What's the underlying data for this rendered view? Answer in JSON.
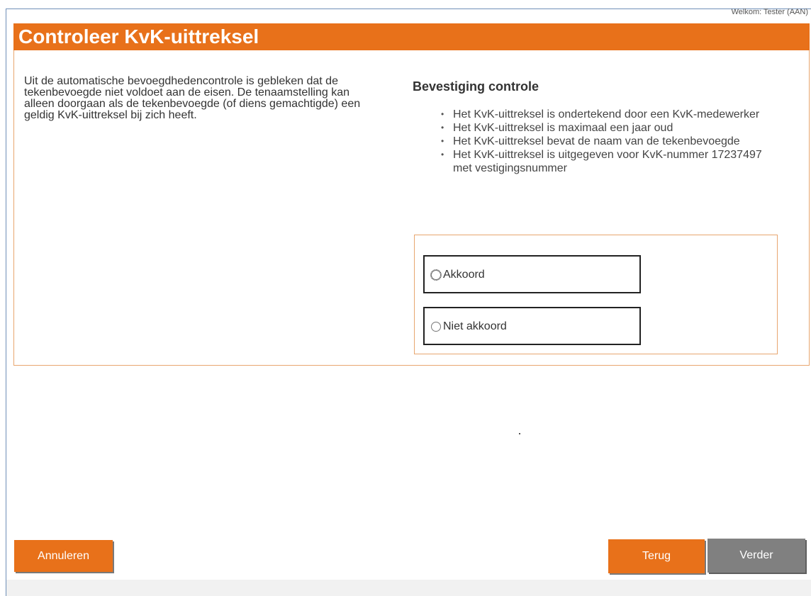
{
  "header": {
    "welcome": "Welkom: Tester (AAN)",
    "title": "Controleer KvK-uittreksel"
  },
  "intro": {
    "text": "Uit de automatische bevoegdhedencontrole is gebleken dat de tekenbevoegde niet voldoet aan de eisen. De tenaamstelling kan alleen doorgaan als de tekenbevoegde (of diens gemachtigde) een geldig KvK-uittreksel bij zich heeft."
  },
  "confirmation": {
    "title": "Bevestiging controle",
    "items": [
      "Het KvK-uittreksel is ondertekend door een KvK-medewerker",
      "Het KvK-uittreksel is maximaal een jaar oud",
      "Het KvK-uittreksel bevat de naam van de tekenbevoegde",
      "Het KvK-uittreksel is uitgegeven voor KvK-nummer 17237497 met vestigingsnummer"
    ],
    "options": [
      {
        "label": "Akkoord",
        "selected": false,
        "focused": true
      },
      {
        "label": "Niet akkoord",
        "selected": false,
        "focused": false
      }
    ]
  },
  "footer": {
    "cancel_label": "Annuleren",
    "back_label": "Terug",
    "next_label": "Verder"
  },
  "colors": {
    "accent": "#e8711a",
    "disabled": "#808080",
    "panel_border": "#e8a66f"
  }
}
